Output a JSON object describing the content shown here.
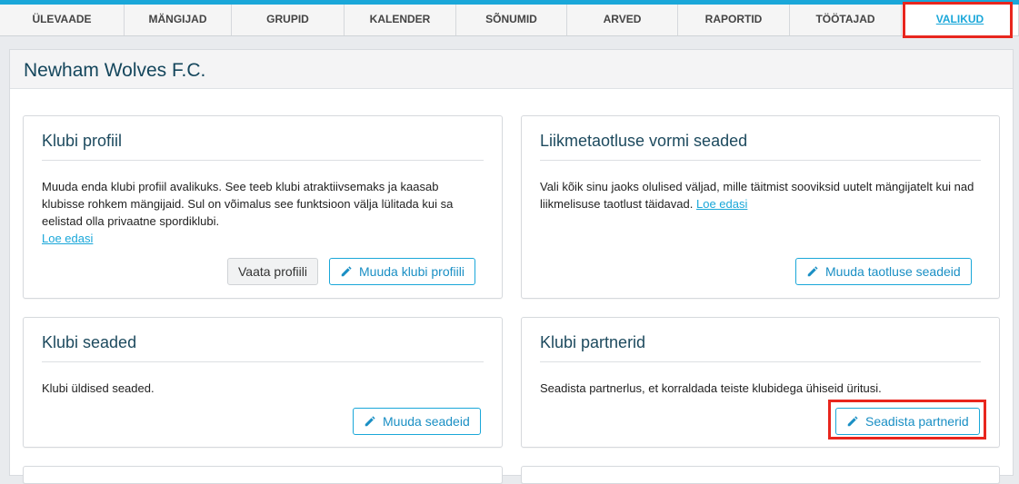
{
  "nav": {
    "tabs": [
      {
        "label": "ÜLEVAADE",
        "active": false
      },
      {
        "label": "MÄNGIJAD",
        "active": false
      },
      {
        "label": "GRUPID",
        "active": false
      },
      {
        "label": "KALENDER",
        "active": false
      },
      {
        "label": "SÕNUMID",
        "active": false
      },
      {
        "label": "ARVED",
        "active": false
      },
      {
        "label": "RAPORTID",
        "active": false
      },
      {
        "label": "TÖÖTAJAD",
        "active": false
      },
      {
        "label": "VALIKUD",
        "active": true
      }
    ]
  },
  "page": {
    "title": "Newham Wolves F.C."
  },
  "cards": {
    "club_profile": {
      "title": "Klubi profiil",
      "description": "Muuda enda klubi profiil avalikuks. See teeb klubi atraktiivsemaks ja kaasab klubisse rohkem mängijaid. Sul on võimalus see funktsioon välja lülitada kui sa eelistad olla privaatne spordiklubi.",
      "read_more": "Loe edasi",
      "view_button": "Vaata profiili",
      "edit_button": "Muuda klubi profiili"
    },
    "application_form": {
      "title": "Liikmetaotluse vormi seaded",
      "description": "Vali kõik sinu jaoks olulised väljad, mille täitmist sooviksid uutelt mängijatelt kui nad liikmelisuse taotlust täidavad.",
      "read_more": "Loe edasi",
      "edit_button": "Muuda taotluse seadeid"
    },
    "club_settings": {
      "title": "Klubi seaded",
      "description": "Klubi üldised seaded.",
      "edit_button": "Muuda seadeid"
    },
    "club_partners": {
      "title": "Klubi partnerid",
      "description": "Seadista partnerlus, et korraldada teiste klubidega ühiseid üritusi.",
      "edit_button": "Seadista partnerid"
    }
  },
  "colors": {
    "accent": "#1aa7d9",
    "highlight": "#e8261e",
    "title": "#14465c"
  },
  "icons": {
    "edit": "pencil-icon"
  }
}
